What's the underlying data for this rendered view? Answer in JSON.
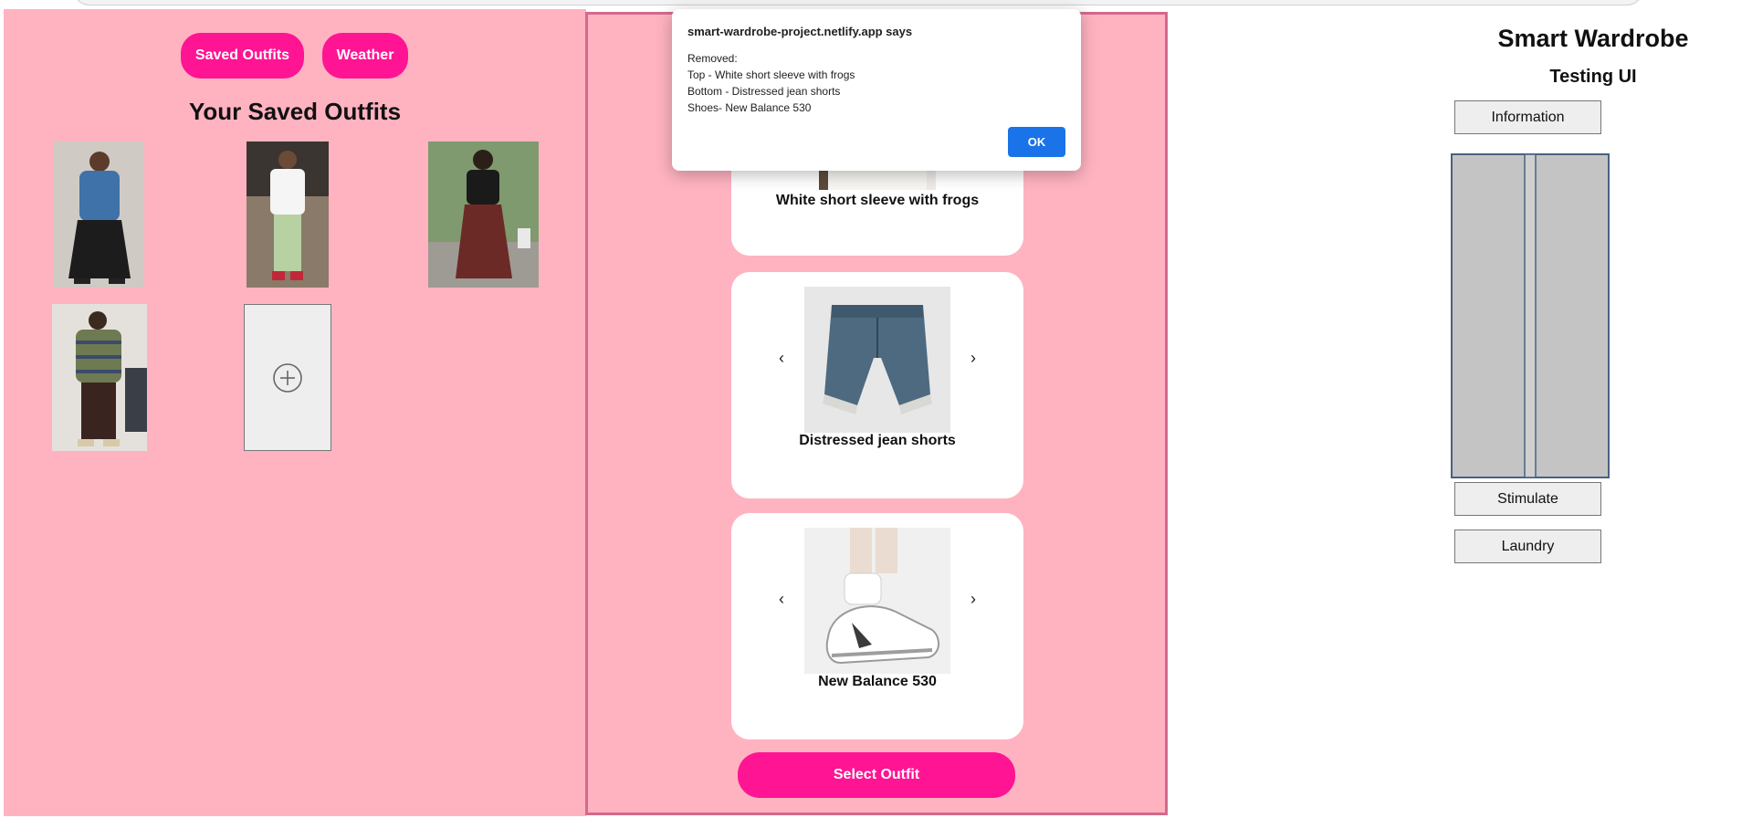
{
  "left_pane": {
    "saved_outfits_button": "Saved Outfits",
    "weather_button": "Weather",
    "title": "Your Saved Outfits"
  },
  "outfit_card_top": {
    "label": "White short sleeve with frogs"
  },
  "outfit_card_bottom": {
    "label": "Distressed jean shorts",
    "prev_arrow": "‹",
    "next_arrow": "›"
  },
  "outfit_card_shoes": {
    "label": "New Balance 530",
    "prev_arrow": "‹",
    "next_arrow": "›"
  },
  "select_outfit_button": "Select Outfit",
  "right_pane": {
    "title": "Smart Wardrobe",
    "subtitle": "Testing UI",
    "information_button": "Information",
    "stimulate_button": "Stimulate",
    "laundry_button": "Laundry"
  },
  "dialog": {
    "origin": "smart-wardrobe-project.netlify.app says",
    "lines": [
      "Removed:",
      "Top - White short sleeve with frogs",
      "Bottom - Distressed jean shorts",
      "Shoes- New Balance 530"
    ],
    "ok_label": "OK"
  },
  "colors": {
    "pane_pink": "#ffb3c1",
    "accent_pink": "#ff1493",
    "dialog_blue": "#1a73e8"
  }
}
